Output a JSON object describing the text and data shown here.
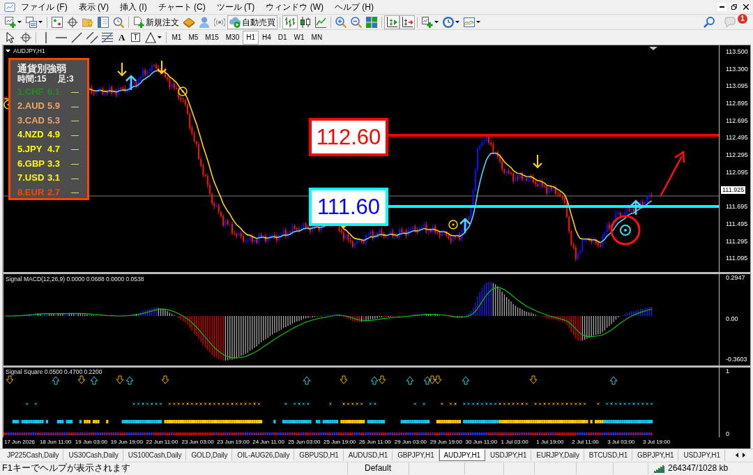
{
  "menu": [
    "ファイル (F)",
    "表示 (V)",
    "挿入 (I)",
    "チャート (C)",
    "ツール (T)",
    "ウィンドウ (W)",
    "ヘルプ (H)"
  ],
  "toolbar": {
    "new_order": "新規注文",
    "auto_trading": {
      "label": "自動売買",
      "on": true
    },
    "chart_types": [
      {
        "selected": true
      },
      {
        "selected": false
      },
      {
        "selected": false
      }
    ],
    "auto_scroll": {
      "on": true
    },
    "chart_shift": {
      "on": true
    },
    "notification_count": "1"
  },
  "draw_tools": {
    "text_tool": "A",
    "label_tool": "T"
  },
  "timeframes": [
    {
      "label": "M1",
      "selected": false
    },
    {
      "label": "M5",
      "selected": false
    },
    {
      "label": "M15",
      "selected": false
    },
    {
      "label": "M30",
      "selected": false
    },
    {
      "label": "H1",
      "selected": true
    },
    {
      "label": "H4",
      "selected": false
    },
    {
      "label": "D1",
      "selected": false
    },
    {
      "label": "W1",
      "selected": false
    },
    {
      "label": "MN",
      "selected": false
    }
  ],
  "chart": {
    "title": "AUDJPY,H1",
    "strength_panel": {
      "title": "通貨別強弱",
      "period": "時間:15",
      "bars": "足:3",
      "rows": [
        {
          "name": "1.CHF",
          "value": "6.1",
          "trend": "—",
          "color": "#228b22"
        },
        {
          "name": "2.AUD",
          "value": "5.9",
          "trend": "—",
          "color": "#f4a460"
        },
        {
          "name": "3.CAD",
          "value": "5.3",
          "trend": "—",
          "color": "#f4a460"
        },
        {
          "name": "4.NZD",
          "value": "4.9",
          "trend": "—",
          "color": "#ffff00"
        },
        {
          "name": "5.JPY",
          "value": "4.7",
          "trend": "—",
          "color": "#ffff00"
        },
        {
          "name": "6.GBP",
          "value": "3.3",
          "trend": "—",
          "color": "#ffff00"
        },
        {
          "name": "7.USD",
          "value": "3.1",
          "trend": "—",
          "color": "#ffff00"
        },
        {
          "name": "8.EUR",
          "value": "2.7",
          "trend": "—",
          "color": "#ff4500"
        }
      ]
    },
    "levels": [
      {
        "color": "#ff0000",
        "label": {
          "text": "112.60",
          "color": "#ff0000"
        }
      },
      {
        "color": "#00ffff",
        "label": {
          "text": "111.60",
          "color": "#0000ff"
        }
      }
    ],
    "price_axis": {
      "upper": [
        "113.500",
        "113.300",
        "113.095",
        "112.895",
        "112.695",
        "112.495",
        "112.295",
        "112.095"
      ],
      "current": "111.925",
      "lower": [
        "111.695",
        "111.495",
        "111.295",
        "111.095"
      ]
    }
  },
  "macd": {
    "title": "Signal MACD(12,26,9) 0.0000 0.0688 0.0000 0.0538",
    "axis": [
      "0.2947",
      "0.00",
      "-0.3603"
    ]
  },
  "signal_square": {
    "title": "Signal Square 0.0500 0.4700 0.2200",
    "axis": [
      "1",
      "0"
    ]
  },
  "time_axis": [
    "17 Jun 2026",
    "18 Jun 11:00",
    "19 Jun 03:00",
    "19 Jun 19:00",
    "22 Jun 11:00",
    "23 Jun 03:00",
    "23 Jun 19:00",
    "24 Jun 11:00",
    "25 Jun 03:00",
    "25 Jun 19:00",
    "26 Jun 11:00",
    "29 Jun 03:00",
    "29 Jun 19:00",
    "30 Jun 11:00",
    "1 Jul 03:00",
    "1 Jul 19:00",
    "2 Jul 11:00",
    "3 Jul 03:00",
    "3 Jul 19:00"
  ],
  "tabs": [
    {
      "label": "JP225Cash,Daily",
      "selected": false
    },
    {
      "label": "US30Cash,Daily",
      "selected": false
    },
    {
      "label": "US100Cash,Daily",
      "selected": false
    },
    {
      "label": "GOLD,Daily",
      "selected": false
    },
    {
      "label": "OIL-AUG26,Daily",
      "selected": false
    },
    {
      "label": "GBPUSD,H1",
      "selected": false
    },
    {
      "label": "AUDUSD,H1",
      "selected": false
    },
    {
      "label": "GBPJPY,H1",
      "selected": false
    },
    {
      "label": "AUDJPY,H1",
      "selected": true
    },
    {
      "label": "USDJPY,H1",
      "selected": false
    },
    {
      "label": "EURJPY,Daily",
      "selected": false
    },
    {
      "label": "BTCUSD,H1",
      "selected": false
    },
    {
      "label": "GBPJPY,H1",
      "selected": false
    },
    {
      "label": "USDJPY,H1",
      "selected": false
    }
  ],
  "status_bar": {
    "help": "F1キーでヘルプが表示されます",
    "profile": "Default",
    "traffic": "264347/1028 kb"
  }
}
